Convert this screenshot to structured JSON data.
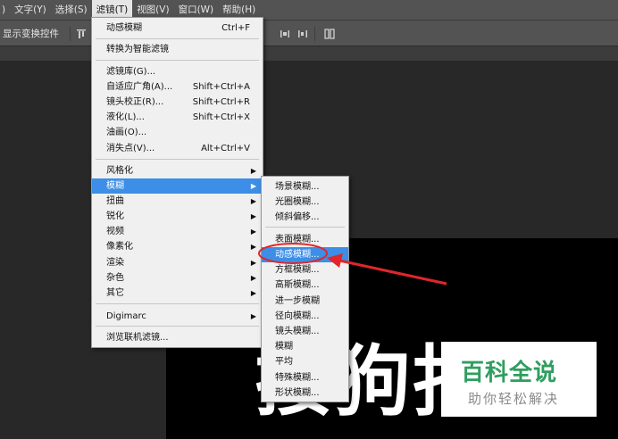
{
  "menubar": {
    "items": [
      ")",
      "文字(Y)",
      "选择(S)",
      "滤镜(T)",
      "视图(V)",
      "窗口(W)",
      "帮助(H)"
    ]
  },
  "options": {
    "label": "显示变换控件"
  },
  "filter_menu": {
    "last_filter": "动感模糊",
    "last_filter_shortcut": "Ctrl+F",
    "smart": "转换为智能滤镜",
    "gallery": "滤镜库(G)...",
    "adaptive": "自适应广角(A)...",
    "adaptive_sc": "Shift+Ctrl+A",
    "lens": "镜头校正(R)...",
    "lens_sc": "Shift+Ctrl+R",
    "liquify": "液化(L)...",
    "liquify_sc": "Shift+Ctrl+X",
    "oil": "油画(O)...",
    "vanish": "消失点(V)...",
    "vanish_sc": "Alt+Ctrl+V",
    "stylize": "风格化",
    "blur": "模糊",
    "distort": "扭曲",
    "sharpen": "锐化",
    "video": "视频",
    "pixelate": "像素化",
    "render": "渲染",
    "noise": "杂色",
    "other": "其它",
    "digimarc": "Digimarc",
    "browse": "浏览联机滤镜..."
  },
  "blur_menu": {
    "items": [
      "场景模糊...",
      "光圈模糊...",
      "倾斜偏移...",
      "表面模糊...",
      "动感模糊...",
      "方框模糊...",
      "高斯模糊...",
      "进一步模糊",
      "径向模糊...",
      "镜头模糊...",
      "模糊",
      "平均",
      "特殊模糊...",
      "形状模糊..."
    ],
    "selected_index": 4
  },
  "canvas": {
    "text": "接狗指南"
  },
  "watermark": {
    "logo": "百科全说",
    "sub": "助你轻松解决"
  },
  "colors": {
    "highlight": "#3c8ee6",
    "annotation": "#e0262b",
    "watermark_green": "#2f9e5f"
  }
}
